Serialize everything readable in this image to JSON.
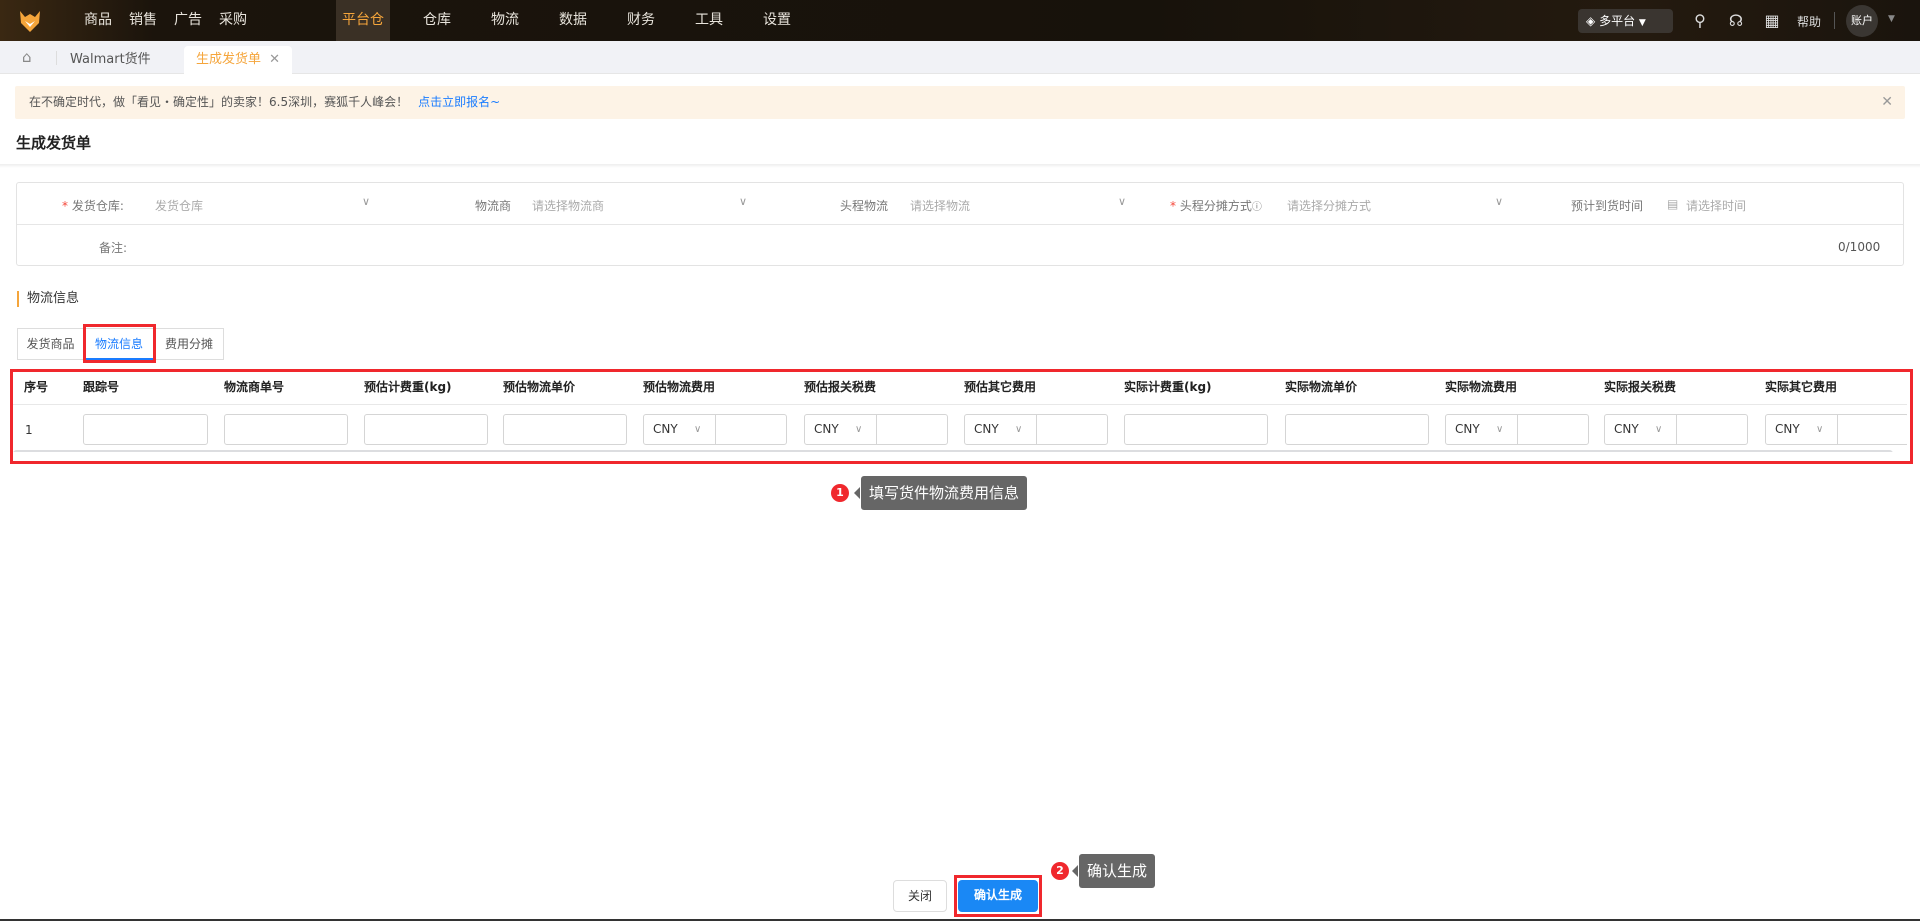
{
  "nav": {
    "menu": [
      "商品",
      "销售",
      "广告",
      "采购",
      "平台仓",
      "仓库",
      "物流",
      "数据",
      "财务",
      "工具",
      "设置"
    ],
    "active": "平台仓",
    "platform": "多平台",
    "help": "帮助",
    "account": "账户"
  },
  "tabs": {
    "items": [
      "Walmart货件",
      "生成发货单"
    ]
  },
  "banner": {
    "text": "在不确定时代，做「看见・确定性」的卖家！6.5深圳，赛狐千人峰会！",
    "link": "点击立即报名~"
  },
  "page": {
    "title": "生成发货单"
  },
  "form": {
    "warehouse_label": "发货仓库:",
    "warehouse_placeholder": "发货仓库",
    "carrier_label": "物流商",
    "carrier_placeholder": "请选择物流商",
    "firstleg_label": "头程物流",
    "firstleg_placeholder": "请选择物流",
    "alloc_label": "头程分摊方式",
    "alloc_placeholder": "请选择分摊方式",
    "eta_label": "预计到货时间",
    "eta_placeholder": "请选择时间",
    "remark_label": "备注:",
    "remark_count": "0/1000"
  },
  "section": {
    "title": "物流信息",
    "tabs": [
      "发货商品",
      "物流信息",
      "费用分摊"
    ]
  },
  "table": {
    "headers": [
      "序号",
      "跟踪号",
      "物流商单号",
      "预估计费重(kg)",
      "预估物流单价",
      "预估物流费用",
      "预估报关税费",
      "预估其它费用",
      "实际计费重(kg)",
      "实际物流单价",
      "实际物流费用",
      "实际报关税费",
      "实际其它费用"
    ],
    "row": {
      "index": "1",
      "currency": "CNY"
    }
  },
  "annotations": [
    {
      "num": "1",
      "text": "填写货件物流费用信息"
    },
    {
      "num": "2",
      "text": "确认生成"
    }
  ],
  "footer": {
    "close": "关闭",
    "confirm": "确认生成"
  },
  "colors": {
    "accent": "#f5a53b",
    "primary": "#1a7cff",
    "highlight": "#f0282d"
  }
}
